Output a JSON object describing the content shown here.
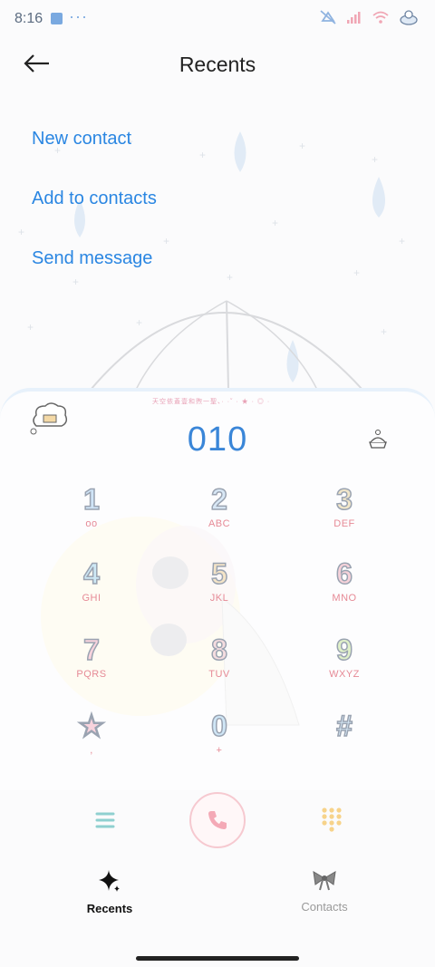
{
  "status_bar": {
    "time": "8:16",
    "dots": "···"
  },
  "header": {
    "title": "Recents"
  },
  "actions": {
    "new_contact": "New contact",
    "add_to_contacts": "Add to contacts",
    "send_message": "Send message"
  },
  "dialer": {
    "marquee": "天空依蓋壹和煦一聖、· ·˘ · ★ · ◎ ·",
    "number": "010",
    "keys": [
      {
        "digit": "1",
        "letters": "oo"
      },
      {
        "digit": "2",
        "letters": "ABC"
      },
      {
        "digit": "3",
        "letters": "DEF"
      },
      {
        "digit": "4",
        "letters": "GHI"
      },
      {
        "digit": "5",
        "letters": "JKL"
      },
      {
        "digit": "6",
        "letters": "MNO"
      },
      {
        "digit": "7",
        "letters": "PQRS"
      },
      {
        "digit": "8",
        "letters": "TUV"
      },
      {
        "digit": "9",
        "letters": "WXYZ"
      },
      {
        "digit": "★",
        "letters": ","
      },
      {
        "digit": "0",
        "letters": "+"
      },
      {
        "digit": "#",
        "letters": ""
      }
    ]
  },
  "nav": {
    "recents": "Recents",
    "contacts": "Contacts"
  },
  "colors": {
    "accent": "#2a86e2",
    "number": "#3a86d8",
    "call_border": "#f6c9d0",
    "key_letters": "#e68a96"
  },
  "icons": {
    "back": "arrow-left-icon",
    "menu": "menu-lines-icon",
    "call": "phone-icon",
    "dialpad": "dialpad-icon",
    "recents": "sparkle-icon",
    "contacts": "bow-icon",
    "cloud": "cloud-cake-icon",
    "cake": "cake-icon"
  }
}
